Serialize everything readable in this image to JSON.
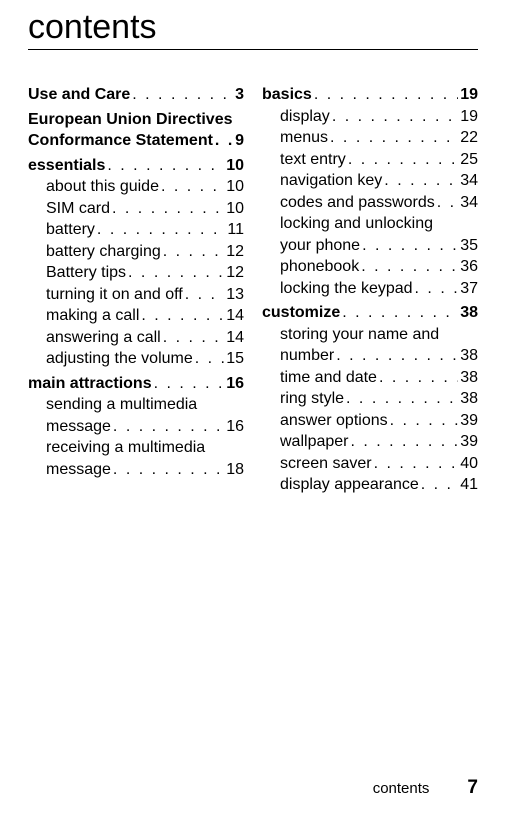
{
  "title": "contents",
  "footer": {
    "label": "contents",
    "page": "7"
  },
  "left": {
    "sections": [
      {
        "type": "section",
        "label": "Use and Care",
        "page": "3"
      },
      {
        "type": "multiline-section",
        "lines": [
          "European Union Directives"
        ],
        "lastLabel": "Conformance Statement",
        "page": "9"
      },
      {
        "type": "section",
        "label": "essentials",
        "page": "10",
        "subs": [
          {
            "label": "about this guide",
            "page": "10"
          },
          {
            "label": "SIM card",
            "page": "10"
          },
          {
            "label": "battery",
            "page": "11"
          },
          {
            "label": "battery charging",
            "page": "12"
          },
          {
            "label": "Battery tips",
            "page": "12"
          },
          {
            "label": "turning it on and off",
            "page": "13"
          },
          {
            "label": "making a call",
            "page": "14"
          },
          {
            "label": "answering a call",
            "page": "14"
          },
          {
            "label": "adjusting the volume",
            "page": "15"
          }
        ]
      },
      {
        "type": "section",
        "label": "main attractions",
        "page": "16",
        "subs": [
          {
            "label": "sending a multimedia",
            "cont": "message",
            "page": "16"
          },
          {
            "label": "receiving a multimedia",
            "cont": "message",
            "page": "18"
          }
        ]
      }
    ]
  },
  "right": {
    "sections": [
      {
        "type": "section",
        "label": "basics",
        "page": "19",
        "subs": [
          {
            "label": "display",
            "page": "19"
          },
          {
            "label": "menus",
            "page": "22"
          },
          {
            "label": "text entry",
            "page": "25"
          },
          {
            "label": "navigation key",
            "page": "34"
          },
          {
            "label": "codes and passwords",
            "page": "34"
          },
          {
            "label": "locking and unlocking",
            "cont": "your phone",
            "page": "35"
          },
          {
            "label": "phonebook",
            "page": "36"
          },
          {
            "label": "locking the keypad",
            "page": "37"
          }
        ]
      },
      {
        "type": "section",
        "label": "customize",
        "page": "38",
        "subs": [
          {
            "label": "storing your name and",
            "cont": "number",
            "page": "38"
          },
          {
            "label": "time and date",
            "page": "38"
          },
          {
            "label": "ring style",
            "page": "38"
          },
          {
            "label": "answer options",
            "page": "39"
          },
          {
            "label": "wallpaper",
            "page": "39"
          },
          {
            "label": "screen saver",
            "page": "40"
          },
          {
            "label": "display appearance",
            "page": "41"
          }
        ]
      }
    ]
  }
}
